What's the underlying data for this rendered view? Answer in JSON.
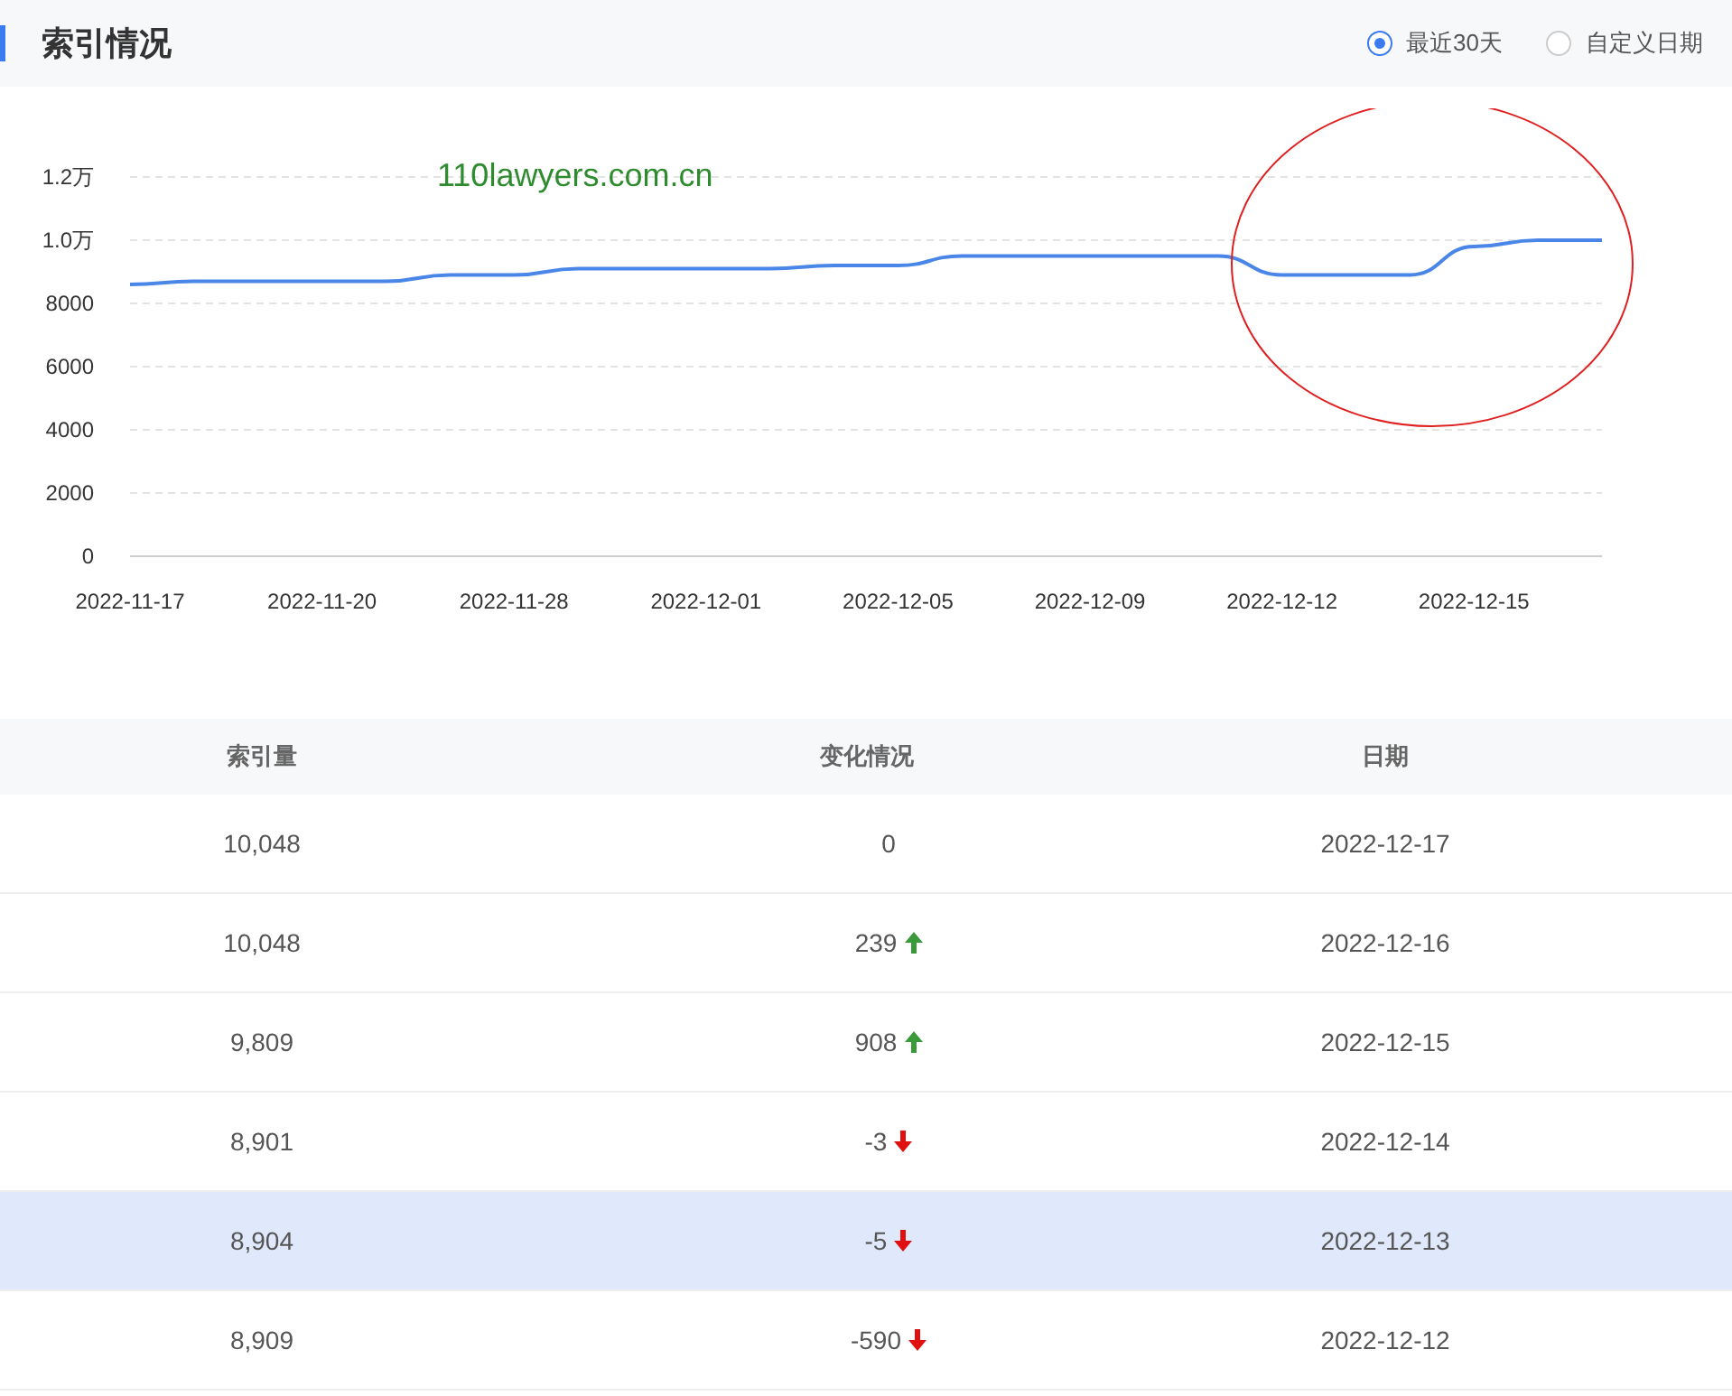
{
  "header": {
    "title": "索引情况",
    "range_options": [
      {
        "label": "最近30天",
        "selected": true
      },
      {
        "label": "自定义日期",
        "selected": false
      }
    ]
  },
  "chart": {
    "overlay_text": "110lawyers.com.cn",
    "circled_region": true,
    "chart_data": {
      "type": "line",
      "categories": [
        "2022-11-17",
        null,
        null,
        "2022-11-20",
        null,
        null,
        "2022-11-28",
        null,
        null,
        "2022-12-01",
        null,
        null,
        "2022-12-05",
        null,
        null,
        "2022-12-09",
        null,
        null,
        "2022-12-12",
        null,
        null,
        "2022-12-15",
        null,
        null
      ],
      "series": [
        {
          "color": "#4a86e8",
          "values": [
            8600,
            8700,
            8700,
            8700,
            8700,
            8900,
            8900,
            9100,
            9100,
            9100,
            9100,
            9200,
            9200,
            9500,
            9500,
            9500,
            9500,
            9500,
            8900,
            8900,
            8900,
            9800,
            10000,
            10000
          ]
        }
      ],
      "ylim": [
        0,
        12000
      ],
      "grid": true,
      "yticks": [
        {
          "value": 0,
          "label": "0"
        },
        {
          "value": 2000,
          "label": "2000"
        },
        {
          "value": 4000,
          "label": "4000"
        },
        {
          "value": 6000,
          "label": "6000"
        },
        {
          "value": 8000,
          "label": "8000"
        }
      ]
    },
    "wan_tick_labels": [
      "1.2万",
      "1.0万"
    ]
  },
  "table": {
    "columns": [
      "索引量",
      "变化情况",
      "日期"
    ],
    "rows": [
      {
        "count": "10,048",
        "change": "0",
        "kind": "none",
        "date": "2022-12-17",
        "selected": false
      },
      {
        "count": "10,048",
        "change": "239",
        "kind": "up",
        "date": "2022-12-16",
        "selected": false
      },
      {
        "count": "9,809",
        "change": "908",
        "kind": "up",
        "date": "2022-12-15",
        "selected": false
      },
      {
        "count": "8,901",
        "change": "-3",
        "kind": "down",
        "date": "2022-12-14",
        "selected": false
      },
      {
        "count": "8,904",
        "change": "-5",
        "kind": "down",
        "date": "2022-12-13",
        "selected": true
      },
      {
        "count": "8,909",
        "change": "-590",
        "kind": "down",
        "date": "2022-12-12",
        "selected": false
      }
    ]
  }
}
